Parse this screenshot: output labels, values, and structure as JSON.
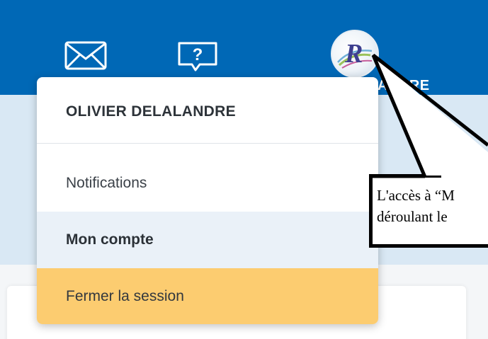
{
  "header": {
    "mail_icon": "envelope-icon",
    "help_icon": "help-question-icon",
    "help_glyph": "?",
    "avatar_icon": "user-avatar-logo",
    "avatar_letters": "R",
    "username_partial": "ANDRE"
  },
  "menu": {
    "user_name": "OLIVIER DELALANDRE",
    "items": [
      {
        "label": "Notifications"
      },
      {
        "label": "Mon compte"
      },
      {
        "label": "Fermer la session"
      }
    ]
  },
  "annotation": {
    "line1": "L'accès à “M",
    "line2": "déroulant le"
  },
  "colors": {
    "topbar": "#0068b6",
    "band": "#d9e8f4",
    "hover_item": "#eaf1f8",
    "logout_item": "#fccc70"
  }
}
